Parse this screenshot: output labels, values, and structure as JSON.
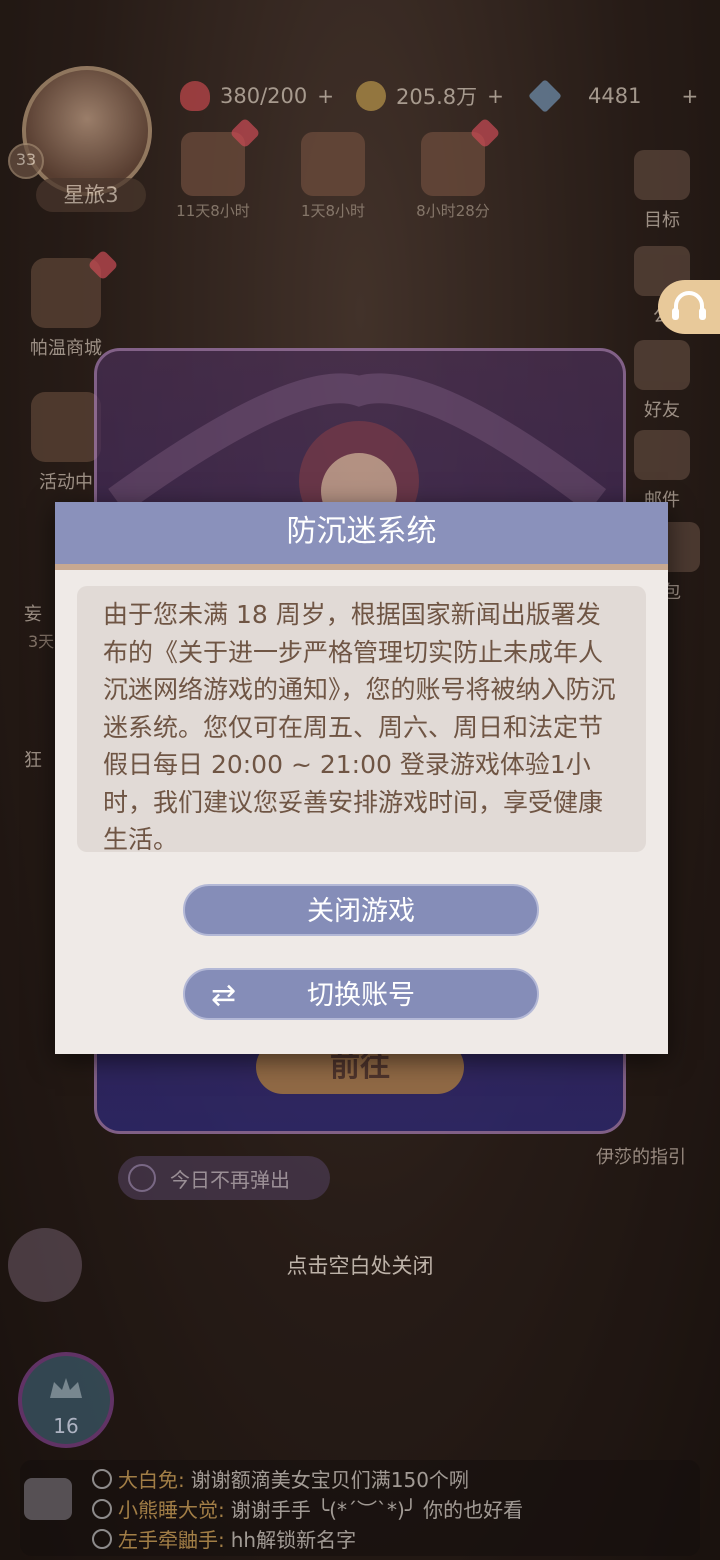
{
  "header": {
    "player_level": "33",
    "player_name": "星旅3",
    "hearts": "380/200",
    "coins": "205.8万",
    "diamonds": "4481",
    "plus": "+"
  },
  "shop_items": [
    {
      "timer": "11天8小时"
    },
    {
      "timer": "1天8小时"
    },
    {
      "timer": "8小时28分"
    }
  ],
  "right_sidebar": {
    "goal": "目标",
    "notice": "公",
    "friends": "好友",
    "mail": "邮件",
    "bag": "包"
  },
  "left_sidebar": {
    "shop": "帕温商城",
    "activity": "活动中",
    "item3": "妄",
    "item3_timer": "3天",
    "item4": "狂"
  },
  "banner": {
    "goto_label": "前往",
    "no_more_label": "今日不再弹出"
  },
  "guide_label": "伊莎的指引",
  "close_hint": "点击空白处关闭",
  "crown_level": "16",
  "dialog": {
    "title": "防沉迷系统",
    "body": "由于您未满 18 周岁，根据国家新闻出版署发布的《关于进一步严格管理切实防止未成年人沉迷网络游戏的通知》，您的账号将被纳入防沉迷系统。您仅可在周五、周六、周日和法定节假日每日 20:00 ~ 21:00 登录游戏体验1小时，我们建议您妥善安排游戏时间，享受健康生活。",
    "close_game": "关闭游戏",
    "switch_account": "切换账号"
  },
  "chat": [
    {
      "who": "大白免:",
      "msg": "谢谢额滴美女宝贝们满150个咧"
    },
    {
      "who": "小熊睡大觉:",
      "msg": "谢谢手手 ╰(*´︶`*)╯ 你的也好看"
    },
    {
      "who": "左手牵鼬手:",
      "msg": "hh解锁新名字"
    }
  ],
  "colors": {
    "dialog_header": "#8a91bb",
    "dialog_bg": "#efeae7",
    "dialog_text": "#6f5544",
    "button": "#858db8"
  }
}
